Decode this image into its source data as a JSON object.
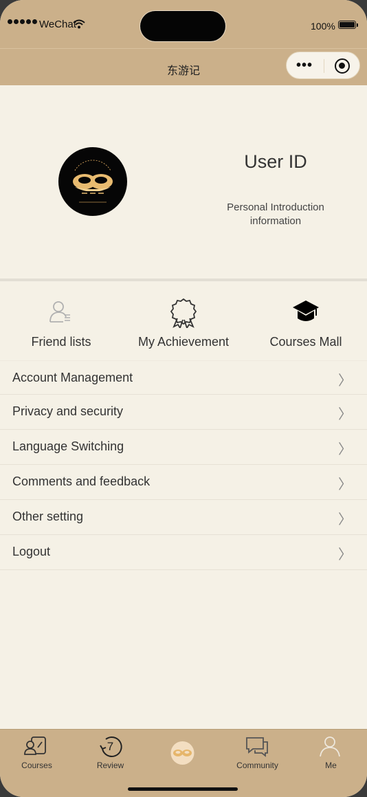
{
  "status_bar": {
    "carrier": "WeChat",
    "battery_percent": "100%",
    "battery_level": 1.0
  },
  "nav": {
    "title": "东游记"
  },
  "profile": {
    "user_id": "User ID",
    "intro_line1": "Personal Introduction",
    "intro_line2": "information",
    "avatar_icon": "dongyouji-logo-icon"
  },
  "quick_actions": [
    {
      "label": "Friend lists",
      "icon": "friend-list-icon"
    },
    {
      "label": "My Achievement",
      "icon": "award-badge-icon"
    },
    {
      "label": "Courses Mall",
      "icon": "graduation-cap-icon"
    }
  ],
  "menu": [
    {
      "label": "Account Management"
    },
    {
      "label": "Privacy and security"
    },
    {
      "label": "Language Switching"
    },
    {
      "label": "Comments and feedback"
    },
    {
      "label": "Other setting"
    },
    {
      "label": "Logout"
    }
  ],
  "chevron": "〉",
  "tabs": [
    {
      "label": "Courses",
      "icon": "courses-icon"
    },
    {
      "label": "Review",
      "icon": "review-7-icon"
    },
    {
      "label": "",
      "icon": "home-logo-icon"
    },
    {
      "label": "Community",
      "icon": "chat-bubbles-icon"
    },
    {
      "label": "Me",
      "icon": "person-icon"
    }
  ],
  "colors": {
    "bar": "#cbb08a",
    "page": "#f5f1e6",
    "text": "#333333",
    "accent_gold": "#e6b66b"
  }
}
